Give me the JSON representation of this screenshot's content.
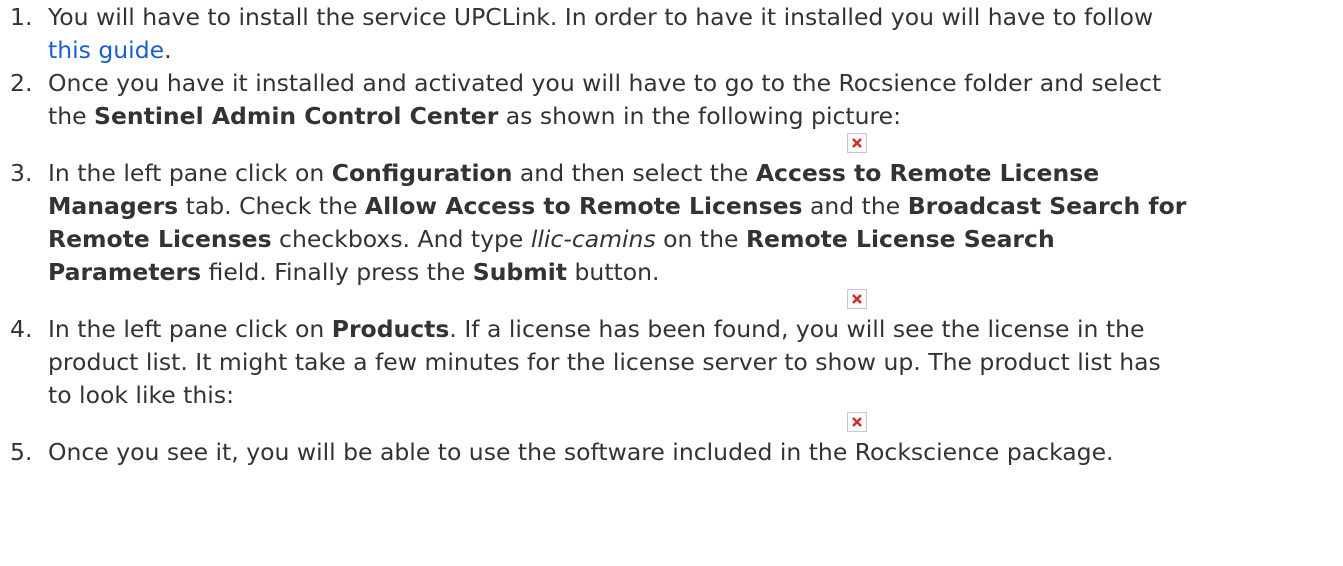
{
  "steps": [
    {
      "num": "1.",
      "lines": [
        {
          "text": "You will have to install the service UPCLink. In order to have it installed you will have to follow"
        },
        {
          "link": "this guide",
          "after": "."
        }
      ]
    },
    {
      "num": "2.",
      "line1": "Once you have it installed and activated you will have to go to the Rocsience folder and select",
      "l2_pre": "the ",
      "l2_bold": "Sentinel Admin Control Center",
      "l2_post": " as shown in the following picture:"
    },
    {
      "num": "3.",
      "l1_pre": "In the left pane click on ",
      "l1_b1": "Configuration",
      "l1_mid": " and then select the ",
      "l1_b2": "Access to Remote License",
      "l2_b": "Managers",
      "l2_mid": " tab. Check the ",
      "l2_b2": "Allow Access to Remote Licenses",
      "l2_mid2": " and the ",
      "l2_b3": "Broadcast Search for",
      "l3_b": "Remote Licenses",
      "l3_mid": " checkboxs. And type ",
      "l3_i": "llic-camins",
      "l3_mid2": " on the ",
      "l3_b2": "Remote License Search",
      "l4_b": "Parameters",
      "l4_mid": " field. Finally press the ",
      "l4_b2": "Submit",
      "l4_post": " button."
    },
    {
      "num": "4.",
      "l1_pre": "In the left pane click on ",
      "l1_b": "Products",
      "l1_post": ". If a license has been found, you will see the license in the",
      "line2": "product list. It might take a few minutes for the license server to show up. The product list has",
      "line3": "to look like this:"
    },
    {
      "num": "5.",
      "line1": "Once you see it, you will be able to use the software included in the Rockscience package."
    }
  ],
  "images": [
    {
      "icon": "broken-image-icon"
    },
    {
      "icon": "broken-image-icon"
    },
    {
      "icon": "broken-image-icon"
    }
  ]
}
